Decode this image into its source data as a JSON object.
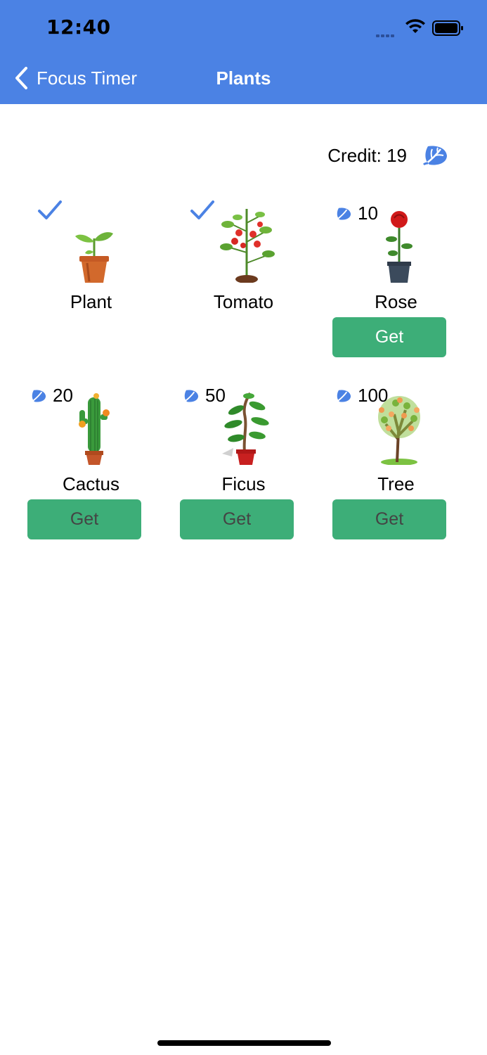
{
  "status_bar": {
    "time": "12:40"
  },
  "nav": {
    "back_label": "Focus Timer",
    "title": "Plants"
  },
  "credit": {
    "label": "Credit: 19",
    "icon": "leaf-icon"
  },
  "plants": [
    {
      "name": "Plant",
      "owned": true
    },
    {
      "name": "Tomato",
      "owned": true
    },
    {
      "name": "Rose",
      "owned": false,
      "cost": "10",
      "button": "Get"
    },
    {
      "name": "Cactus",
      "owned": false,
      "cost": "20",
      "button": "Get"
    },
    {
      "name": "Ficus",
      "owned": false,
      "cost": "50",
      "button": "Get"
    },
    {
      "name": "Tree",
      "owned": false,
      "cost": "100",
      "button": "Get"
    }
  ],
  "colors": {
    "header": "#4b82e4",
    "button": "#3dae78",
    "accent": "#4b82e4"
  }
}
